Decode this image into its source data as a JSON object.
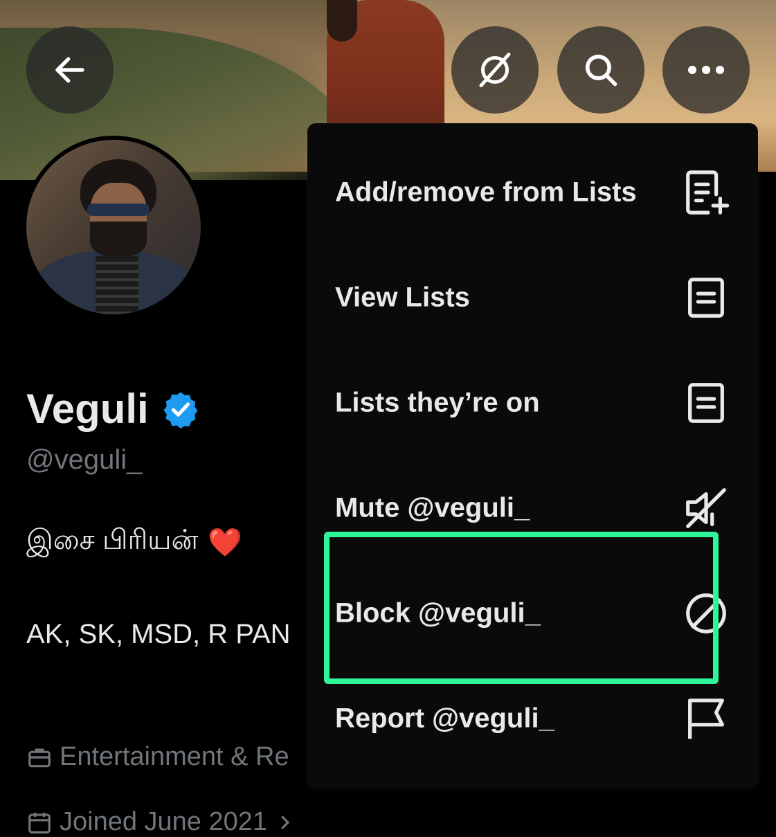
{
  "profile": {
    "name": "Veguli",
    "handle": "@veguli_",
    "bio_line1": "இசை பிரியன்",
    "bio_heart": "❤️",
    "bio_line2": "AK, SK, MSD, R PAN",
    "category": "Entertainment & Re",
    "joined": "Joined June 2021"
  },
  "menu": {
    "items": [
      {
        "label": "Add/remove from Lists",
        "icon": "list-add-icon"
      },
      {
        "label": "View Lists",
        "icon": "list-icon"
      },
      {
        "label": "Lists they’re on",
        "icon": "list-icon"
      },
      {
        "label": "Mute @veguli_",
        "icon": "speaker-mute-icon"
      },
      {
        "label": "Block @veguli_",
        "icon": "block-icon"
      },
      {
        "label": "Report @veguli_",
        "icon": "flag-icon"
      }
    ]
  },
  "colors": {
    "highlight": "#2ef598",
    "verified": "#1d9bf0",
    "background": "#000000",
    "menu_background": "#0a0a0a"
  }
}
